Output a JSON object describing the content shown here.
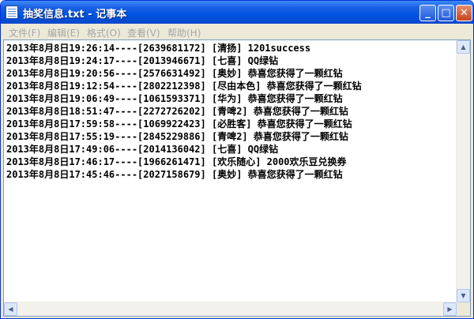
{
  "window": {
    "title": "抽奖信息.txt - 记事本",
    "buttons": {
      "minimize": "_",
      "maximize": "□",
      "close": "✕"
    }
  },
  "menu": [
    {
      "label": "文件(F)"
    },
    {
      "label": "编辑(E)"
    },
    {
      "label": "格式(O)"
    },
    {
      "label": "查看(V)"
    },
    {
      "label": "帮助(H)"
    }
  ],
  "lines": [
    "2013年8月8日19:26:14----[2639681172] [清扬] 1201success",
    "2013年8月8日19:24:17----[2013946671] [七喜] QQ绿钻",
    "2013年8月8日19:20:56----[2576631492] [奥妙] 恭喜您获得了一颗红钻",
    "2013年8月8日19:12:54----[2802212398] [尽由本色] 恭喜您获得了一颗红钻",
    "2013年8月8日19:06:49----[1061593371] [华为] 恭喜您获得了一颗红钻",
    "2013年8月8日18:51:47----[2272726202] [青啤2] 恭喜您获得了一颗红钻",
    "2013年8月8日17:59:58----[1069922423] [必胜客] 恭喜您获得了一颗红钻",
    "2013年8月8日17:55:19----[2845229886] [青啤2] 恭喜您获得了一颗红钻",
    "2013年8月8日17:49:06----[2014136042] [七喜] QQ绿钻",
    "2013年8月8日17:46:17----[1966261471] [欢乐随心] 2000欢乐豆兑换券",
    "2013年8月8日17:45:46----[2027158679] [奥妙] 恭喜您获得了一颗红钻"
  ],
  "scroll": {
    "up": "▲",
    "down": "▼",
    "left": "◀",
    "right": "▶"
  },
  "colors": {
    "titlebar": "#0054e3",
    "menu_disabled_text": "#a7a7a7",
    "background": "#ece9d8"
  }
}
